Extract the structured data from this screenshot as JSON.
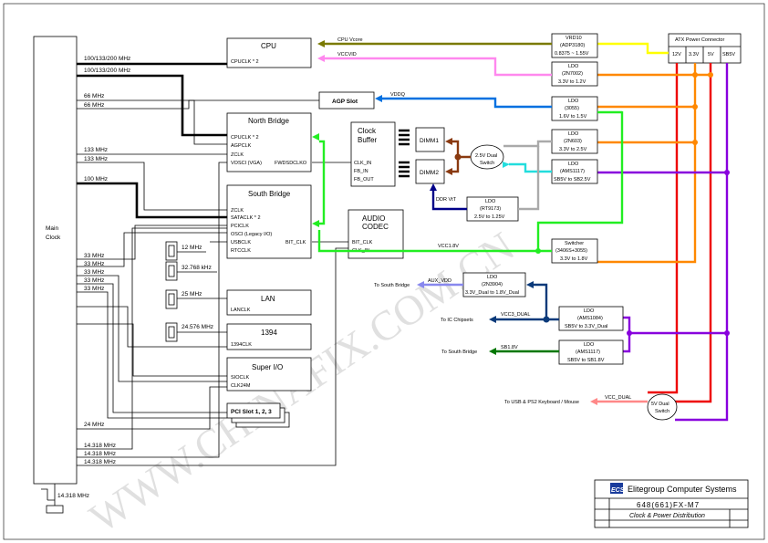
{
  "main_clock": {
    "line1": "Main",
    "line2": "Clock"
  },
  "blocks": {
    "cpu": {
      "title": "CPU",
      "pins": [
        "CPUCLK * 2"
      ]
    },
    "agp": {
      "title": "AGP Slot"
    },
    "north_bridge": {
      "title": "North Bridge",
      "pins": [
        "CPUCLK * 2",
        "AGPCLK",
        "ZCLK",
        "VOSCI (VGA)",
        "FWDSDCLKO"
      ]
    },
    "south_bridge": {
      "title": "South Bridge",
      "pins": [
        "ZCLK",
        "SATACLK * 2",
        "PCICLK",
        "OSCI (Legacy I/O)",
        "USBCLK",
        "RTCCLK",
        "BIT_CLK"
      ]
    },
    "clock_buffer": {
      "title1": "Clock",
      "title2": "Buffer",
      "pins": [
        "CLK_IN",
        "FB_IN",
        "FB_OUT"
      ]
    },
    "dimm1": {
      "title": "DIMM1"
    },
    "dimm2": {
      "title": "DIMM2"
    },
    "audio_codec": {
      "title1": "AUDIO",
      "title2": "CODEC",
      "pins": [
        "BIT_CLK",
        "CLK_IN"
      ]
    },
    "lan": {
      "title": "LAN",
      "pins": [
        "LANCLK"
      ]
    },
    "ieee1394": {
      "title": "1394",
      "pins": [
        "1394CLK"
      ]
    },
    "super_io": {
      "title": "Super I/O",
      "pins": [
        "SIOCLK",
        "CLK24M"
      ]
    },
    "pci_slot": {
      "title": "PCI Slot 1, 2, 3"
    },
    "crystal_12": {
      "label": "12 MHz"
    },
    "crystal_32": {
      "label": "32.768 kHz"
    },
    "crystal_25": {
      "label": "25 MHz"
    },
    "crystal_24576": {
      "label": "24.576 MHz"
    }
  },
  "clock_labels": {
    "cpu1": "100/133/200 MHz",
    "cpu2": "100/133/200 MHz",
    "agp1": "66 MHz",
    "agp2": "66 MHz",
    "nb1": "133 MHz",
    "nb2": "133 MHz",
    "sb": "100 MHz",
    "m33_1": "33 MHz",
    "m33_2": "33 MHz",
    "m33_3": "33 MHz",
    "m33_4": "33 MHz",
    "m33_5": "33 MHz",
    "m24": "24 MHz",
    "osc1": "14.318 MHz",
    "osc2": "14.318 MHz",
    "osc3": "14.318 MHz",
    "osc_main": "14.318 MHz"
  },
  "power": {
    "atx": {
      "title": "ATX Power Connector",
      "pins": [
        "12V",
        "3.3V",
        "5V",
        "SB5V"
      ]
    },
    "vrd10": {
      "lines": [
        "VRD10",
        "(ADP3180)",
        "0.8375 ~ 1.55V"
      ]
    },
    "ldo_2n7002": {
      "lines": [
        "LDO",
        "(2N7002)",
        "3.3V to 1.2V"
      ]
    },
    "ldo_3055": {
      "lines": [
        "LDO",
        "(3055)",
        "1.6V to 1.5V"
      ]
    },
    "ldo_2n603": {
      "lines": [
        "LDO",
        "(2N603)",
        "3.3V to 2.5V"
      ]
    },
    "ldo_ams1117_a": {
      "lines": [
        "LDO",
        "(AMS1117)",
        "SB5V to SB2.5V"
      ]
    },
    "ldo_rt9173": {
      "lines": [
        "LDO",
        "(RT9173)",
        "2.5V to 1.25V"
      ]
    },
    "switcher": {
      "lines": [
        "Switcher",
        "(3406S+3055)",
        "3.3V to 1.8V"
      ]
    },
    "ldo_2n3904": {
      "lines": [
        "LDO",
        "(2N3904)",
        "3.3V_Dual to 1.8V_Dual"
      ]
    },
    "ldo_ams1084": {
      "lines": [
        "LDO",
        "(AMS1084)",
        "SB5V to 3.3V_Dual"
      ]
    },
    "ldo_ams1117_b": {
      "lines": [
        "LDO",
        "(AMS1117)",
        "SB5V to SB1.8V"
      ]
    },
    "dual_25": {
      "line1": "2.5V Dual",
      "line2": "Switch"
    },
    "dual_5": {
      "line1": "5V Dual",
      "line2": "Switch"
    }
  },
  "rails": {
    "cpu_vcore": "CPU Vcore",
    "vccvid": "VCCVID",
    "vddq": "VDDQ",
    "ddr_vtt": "DDR VtT",
    "vcc18": "VCC1.8V",
    "aux_vdd": "AUX_VDD",
    "vcc3_dual": "VCC3_DUAL",
    "sb18": "SB1.8V",
    "vcc_dual": "VCC_DUAL"
  },
  "destinations": {
    "to_sb_1": "To South Bridge",
    "to_ic": "To IC Chipsets",
    "to_sb_2": "To South Bridge",
    "to_usb": "To USB & PS2 Keyboard / Mouse"
  },
  "colors": {
    "olive": "#7a7a00",
    "pink": "#ff88ee",
    "yellow": "#ffff00",
    "orange": "#ff8800",
    "blue": "#0070e0",
    "green": "#22ee22",
    "brown": "#8a3a10",
    "cyan": "#22dddd",
    "purple": "#8800dd",
    "navy": "#000088",
    "gray": "#aaaaaa",
    "lavender": "#8888ee",
    "dark_green": "#007700",
    "salmon": "#ff8888",
    "red": "#ee0000",
    "logo_blue": "#1a3c9c"
  },
  "watermark": "WWW.CHINAFIX.COM.CN",
  "title_block": {
    "company": "Elitegroup Computer Systems",
    "logo": "ECS",
    "board": "648(661)FX-M7",
    "page_title": "Clock & Power Distribution"
  }
}
